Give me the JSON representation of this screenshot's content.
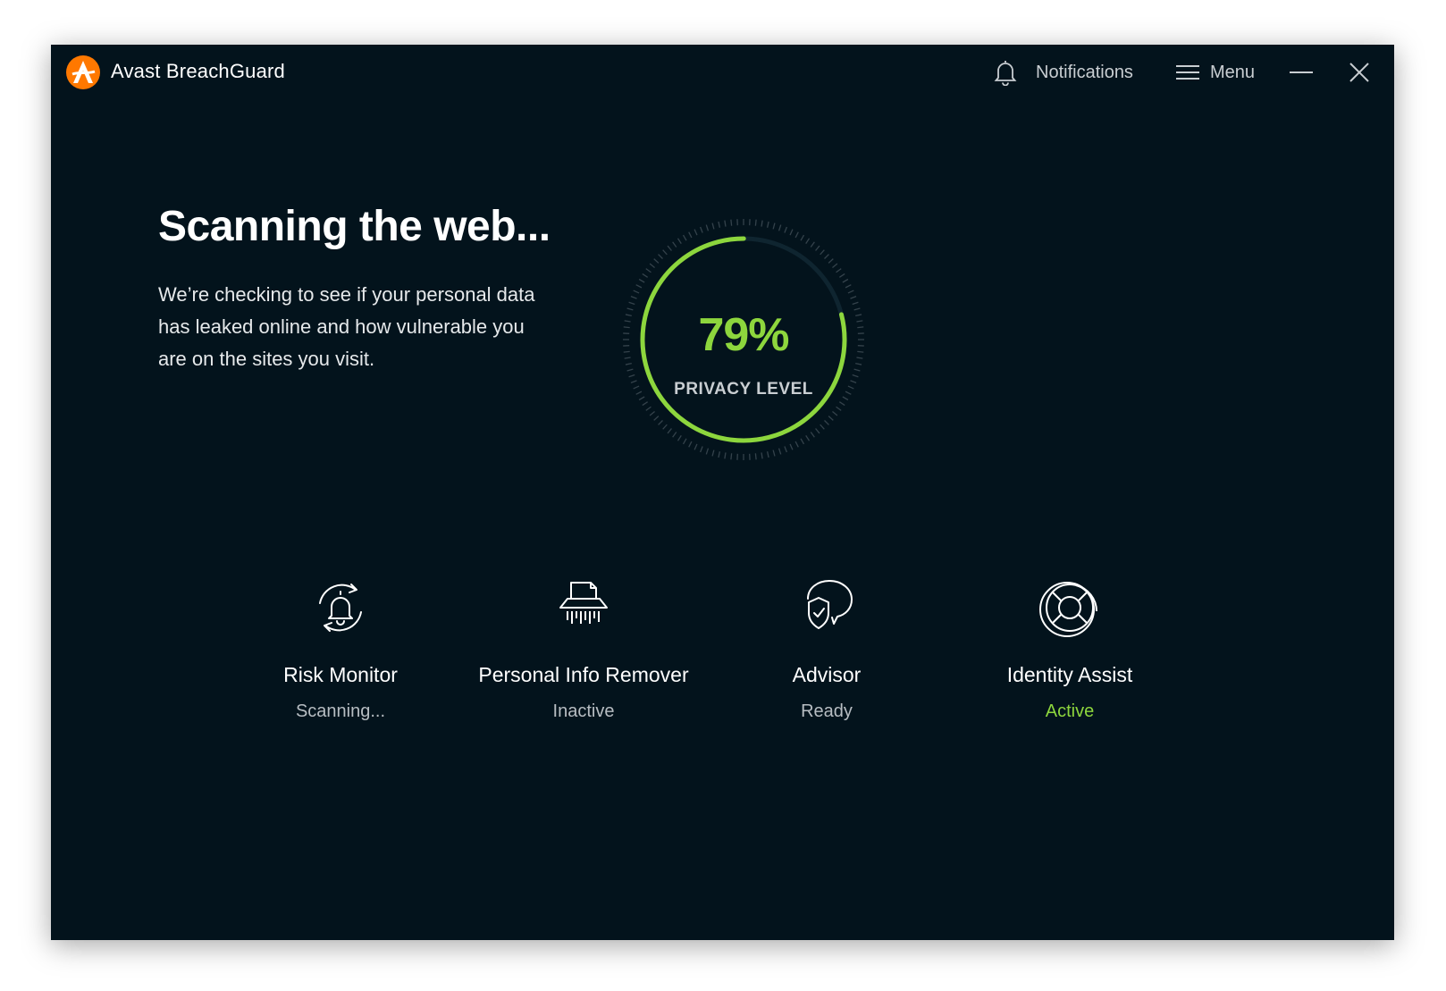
{
  "app": {
    "title": "Avast BreachGuard",
    "logo_icon": "avast-logo-icon"
  },
  "titlebar": {
    "notifications_label": "Notifications",
    "menu_label": "Menu",
    "notifications_icon": "bell-icon",
    "menu_icon": "hamburger-icon",
    "minimize_icon": "minimize-icon",
    "close_icon": "close-icon"
  },
  "main": {
    "headline": "Scanning the web...",
    "description": "We’re checking to see if your personal data has leaked online and how vulnerable you are on the sites you visit."
  },
  "gauge": {
    "value_text": "79%",
    "value": 79,
    "label": "PRIVACY LEVEL"
  },
  "features": [
    {
      "name": "Risk Monitor",
      "status": "Scanning...",
      "icon": "bell-refresh-icon"
    },
    {
      "name": "Personal Info Remover",
      "status": "Inactive",
      "icon": "shredder-icon"
    },
    {
      "name": "Advisor",
      "status": "Ready",
      "icon": "chat-shield-icon"
    },
    {
      "name": "Identity Assist",
      "status": "Active",
      "icon": "lifebuoy-icon"
    }
  ],
  "colors": {
    "background": "#03131c",
    "accent_green": "#8dd63d",
    "brand_orange": "#ff7800",
    "text_muted": "#b7bdc2"
  }
}
